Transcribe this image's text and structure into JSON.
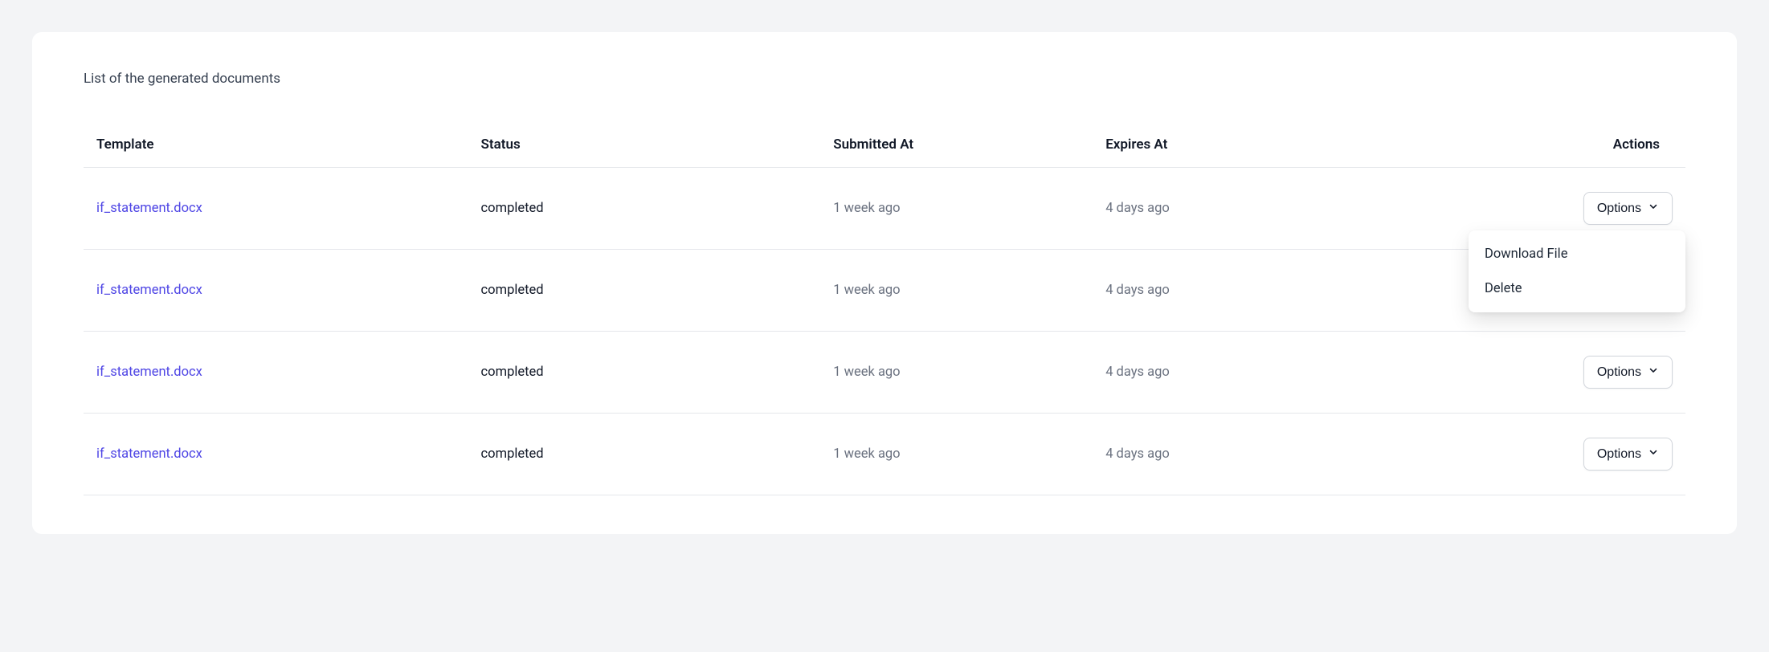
{
  "subtitle": "List of the generated documents",
  "headers": {
    "template": "Template",
    "status": "Status",
    "submitted": "Submitted At",
    "expires": "Expires At",
    "actions": "Actions"
  },
  "options_label": "Options",
  "dropdown": {
    "download": "Download File",
    "delete": "Delete"
  },
  "rows": [
    {
      "template": "if_statement.docx",
      "status": "completed",
      "submitted": "1 week ago",
      "expires": "4 days ago",
      "dropdown_open": true
    },
    {
      "template": "if_statement.docx",
      "status": "completed",
      "submitted": "1 week ago",
      "expires": "4 days ago",
      "dropdown_open": false
    },
    {
      "template": "if_statement.docx",
      "status": "completed",
      "submitted": "1 week ago",
      "expires": "4 days ago",
      "dropdown_open": false
    },
    {
      "template": "if_statement.docx",
      "status": "completed",
      "submitted": "1 week ago",
      "expires": "4 days ago",
      "dropdown_open": false
    }
  ]
}
